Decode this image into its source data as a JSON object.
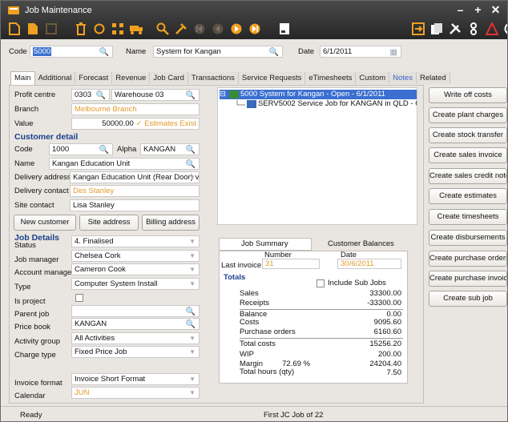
{
  "window": {
    "title": "Job Maintenance"
  },
  "header": {
    "code_label": "Code",
    "code_value": "5000",
    "name_label": "Name",
    "name_value": "System for Kangan",
    "date_label": "Date",
    "date_value": "6/1/2011"
  },
  "tabs": [
    "Main",
    "Additional",
    "Forecast",
    "Revenue",
    "Job Card",
    "Transactions",
    "Service Requests",
    "eTimesheets",
    "Custom",
    "Notes",
    "Related"
  ],
  "main": {
    "profit_centre_label": "Profit centre",
    "profit_centre_value": "0303",
    "warehouse_value": "Warehouse 03",
    "branch_label": "Branch",
    "branch_value": "Melbourne Branch",
    "value_label": "Value",
    "value_value": "50000.00",
    "estimates_text": "Estimates Exist"
  },
  "customer": {
    "section": "Customer detail",
    "code_label": "Code",
    "code_value": "1000",
    "alpha_label": "Alpha",
    "alpha_value": "KANGAN",
    "name_label": "Name",
    "name_value": "Kangan Education Unit",
    "delivery_address_label": "Delivery address",
    "delivery_address_value": "Kangan Education Unit (Rear Door) via",
    "delivery_contact_label": "Delivery contact",
    "delivery_contact_value": "Des Stanley",
    "site_contact_label": "Site contact",
    "site_contact_value": "Lisa Stanley",
    "new_customer": "New customer",
    "site_address": "Site address",
    "billing_address": "Billing address"
  },
  "job": {
    "section": "Job Details",
    "status_label": "Status",
    "status_value": "4. Finalised",
    "job_manager_label": "Job manager",
    "job_manager_value": "Chelsea Cork",
    "account_manager_label": "Account manager",
    "account_manager_value": "Cameron Cook",
    "type_label": "Type",
    "type_value": "Computer System Install",
    "is_project_label": "Is project",
    "parent_job_label": "Parent job",
    "parent_job_value": "",
    "price_book_label": "Price book",
    "price_book_value": "KANGAN",
    "activity_group_label": "Activity group",
    "activity_group_value": "All Activities",
    "charge_type_label": "Charge type",
    "charge_type_value": "Fixed Price Job",
    "invoice_format_label": "Invoice format",
    "invoice_format_value": "Invoice Short Format",
    "calendar_label": "Calendar",
    "calendar_value": "JUN"
  },
  "tree": {
    "item1": "5000 System for Kangan - Open - 6/1/2011",
    "item2": "SERV5002 Service Job for KANGAN in QLD - Open -"
  },
  "summary": {
    "tab1": "Job Summary",
    "tab2": "Customer Balances",
    "number_header": "Number",
    "date_header": "Date",
    "last_invoice_label": "Last invoice",
    "last_invoice_number": "31",
    "last_invoice_date": "30/6/2011",
    "totals_label": "Totals",
    "include_sub_jobs": "Include Sub Jobs",
    "rows": [
      {
        "label": "Sales",
        "value": "33300.00"
      },
      {
        "label": "Receipts",
        "value": "-33300.00"
      },
      {
        "label": "Balance",
        "value": "0.00"
      },
      {
        "label": "Costs",
        "value": "9095.60"
      },
      {
        "label": "Purchase orders",
        "value": "6160.60"
      },
      {
        "label": "Total costs",
        "value": "15256.20"
      },
      {
        "label": "WIP",
        "value": "200.00"
      },
      {
        "label": "Margin",
        "value": "24204.40"
      },
      {
        "label": "Total hours (qty)",
        "value": "7.50"
      }
    ],
    "margin_pct": "72.69 %"
  },
  "actions": [
    "Write off costs",
    "Create plant charges",
    "Create stock transfer",
    "Create sales invoice",
    "Create sales credit note",
    "Create estimates",
    "Create timesheets",
    "Create disbursements",
    "Create purchase orders",
    "Create purchase invoice",
    "Create sub job"
  ],
  "status": {
    "left": "Ready",
    "center": "First JC Job of 22"
  },
  "colors": {
    "titlebar": "#333333",
    "accent": "#f0a020",
    "link_orange": "#e19a2e",
    "section_blue": "#1c3f8a",
    "selection": "#3b6fd0"
  }
}
